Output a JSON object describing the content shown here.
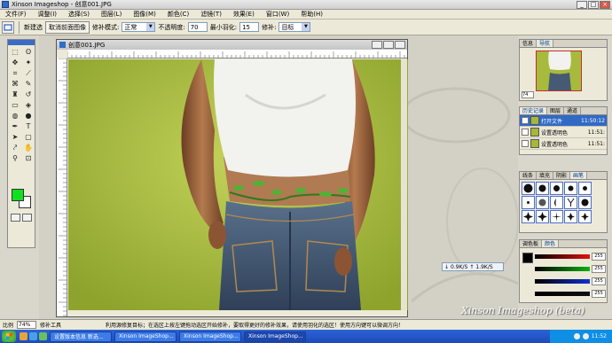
{
  "window": {
    "title": "Xinson Imageshop - 创意001.JPG",
    "min": "_",
    "max": "□",
    "close": "×"
  },
  "menu": [
    "文件(F)",
    "调整(I)",
    "选择(S)",
    "图层(L)",
    "图像(M)",
    "颜色(C)",
    "滤镜(T)",
    "效果(E)",
    "窗口(W)",
    "帮助(H)"
  ],
  "options": {
    "new_selection": "新建选",
    "cancel_selection": "取消前面图像",
    "feather_mode_label": "修补模式:",
    "feather_mode_value": "正常",
    "opacity_label": "不透明度:",
    "opacity_value": "70",
    "min_feather_label": "最小羽化:",
    "min_feather_value": "15",
    "patch_label": "修补:",
    "patch_value": "目标"
  },
  "document": {
    "title": "创意001.JPG"
  },
  "navigator": {
    "tabs": [
      "信息",
      "导航"
    ],
    "zoom": "74"
  },
  "history": {
    "tabs": [
      "历史记录",
      "图层",
      "通道"
    ],
    "rows": [
      {
        "label": "打开文件",
        "time": "11:50:12",
        "selected": true
      },
      {
        "label": "设置透明色",
        "time": "11:51:",
        "selected": false
      },
      {
        "label": "设置透明色",
        "time": "11:51:",
        "selected": false
      }
    ]
  },
  "brushes": {
    "tabs": [
      "线条",
      "填充",
      "阴影",
      "画笔"
    ]
  },
  "colorpanel": {
    "tabs": [
      "调色板",
      "颜色"
    ],
    "sliders": [
      {
        "color": "#e01010",
        "value": "255"
      },
      {
        "color": "#10b010",
        "value": "255"
      },
      {
        "color": "#1030d0",
        "value": "255"
      },
      {
        "color": "#101010",
        "value": "255"
      }
    ]
  },
  "memory": {
    "down": "0.9K/S",
    "up": "1.9K/S"
  },
  "status": {
    "zoom_label": "比例",
    "zoom_value": "74%",
    "tool_name": "修补工具",
    "hint": "利用源修复目标；在选区上按左键拖动选区开始修补，要取得更好的修补效果，请使用羽化的选区！使用方向键可以微调方向！"
  },
  "watermark": "Xinson Imageshop (beta)",
  "taskbar": {
    "buttons": [
      "设置版本信息 新选...",
      "Xinson ImageShop...",
      "Xinson ImageShop...",
      "Xinson ImageShop..."
    ],
    "active_index": 3,
    "clock": "11:52"
  }
}
